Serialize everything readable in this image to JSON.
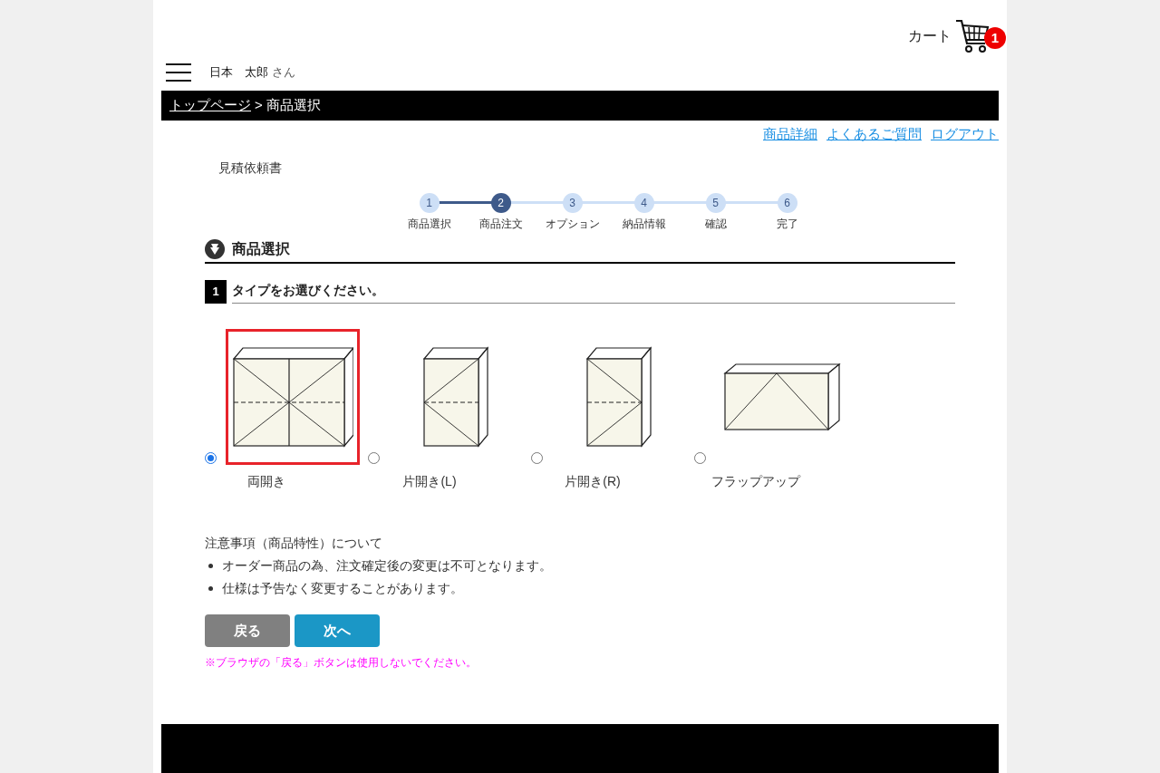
{
  "header": {
    "cart_label": "カート",
    "cart_count": "1",
    "user_name": "日本　太郎",
    "user_suffix": "さん"
  },
  "breadcrumb": [
    {
      "label": "トップページ",
      "link": true
    },
    {
      "label": ">",
      "link": false
    },
    {
      "label": "商品選択",
      "link": false
    }
  ],
  "top_links": [
    "商品詳細",
    "よくあるご質問",
    "ログアウト"
  ],
  "page_title": "見積依頼書",
  "steps": [
    {
      "number": "1",
      "label": "商品選択",
      "selected": false
    },
    {
      "number": "2",
      "label": "商品注文",
      "selected": true
    },
    {
      "number": "3",
      "label": "オプション",
      "selected": false
    },
    {
      "number": "4",
      "label": "納品情報",
      "selected": false
    },
    {
      "number": "5",
      "label": "確認",
      "selected": false
    },
    {
      "number": "6",
      "label": "完了",
      "selected": false
    }
  ],
  "section_title": "商品選択",
  "question": {
    "number": "1",
    "text": "タイプをお選びください。"
  },
  "options": [
    {
      "kind": "double",
      "label": "両開き",
      "selected": true
    },
    {
      "kind": "left",
      "label": "片開き(L)",
      "selected": false
    },
    {
      "kind": "right",
      "label": "片開き(R)",
      "selected": false
    },
    {
      "kind": "flap",
      "label": "フラップアップ",
      "selected": false
    }
  ],
  "notes": {
    "title": "注意事項（商品特性）について",
    "items": [
      "オーダー商品の為、注文確定後の変更は不可となります。",
      "仕様は予告なく変更することがあります。"
    ]
  },
  "buttons": {
    "back": "戻る",
    "next": "次へ"
  },
  "warning": "※ブラウザの「戻る」ボタンは使用しないでください。"
}
